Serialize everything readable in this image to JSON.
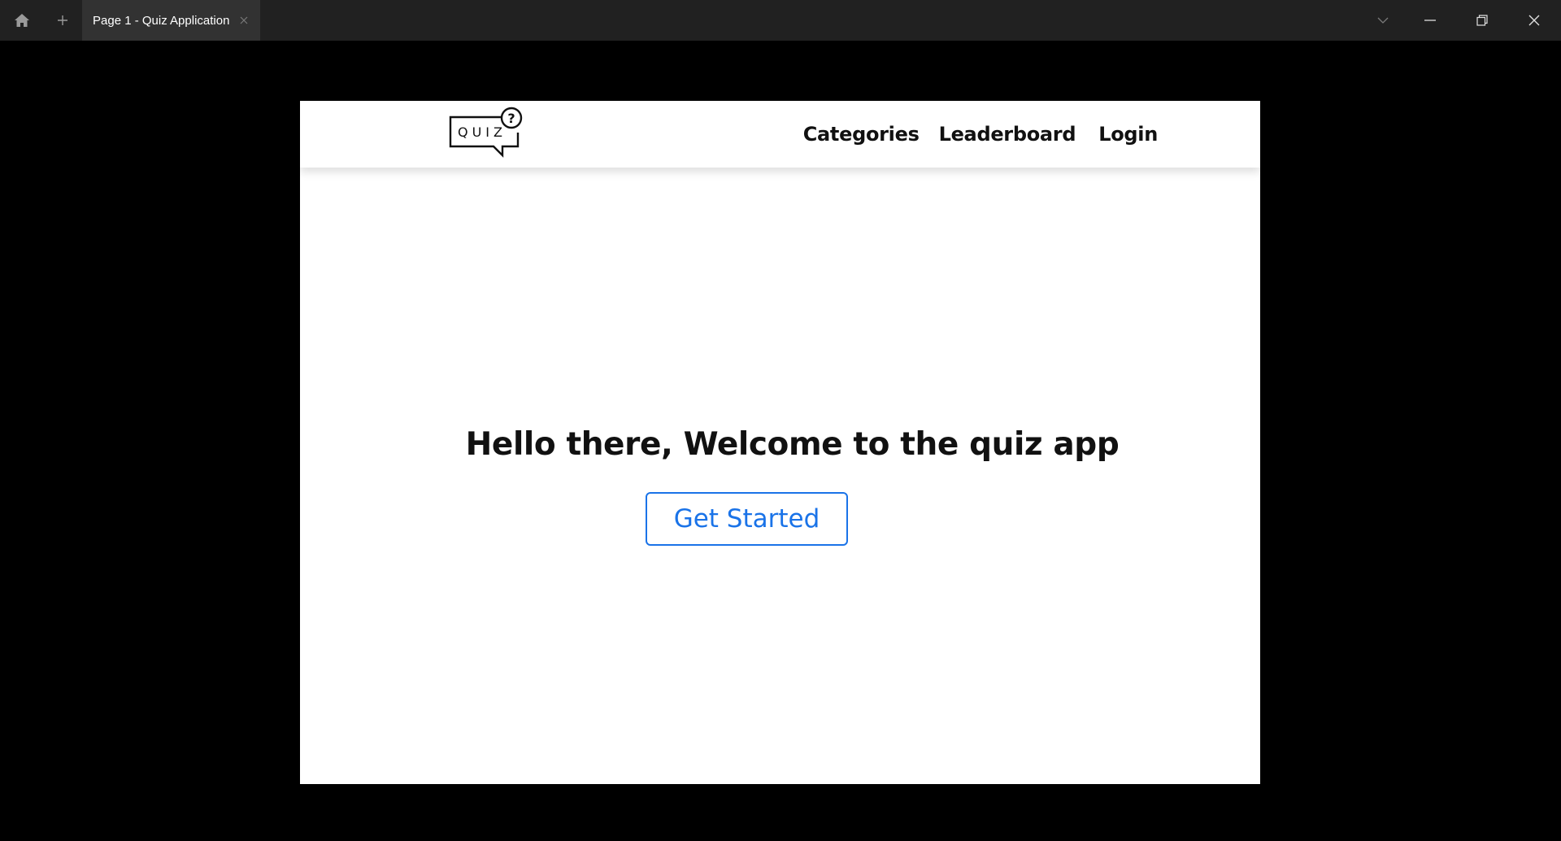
{
  "browser": {
    "tab_title": "Page 1 - Quiz Application",
    "icons": {
      "home": "home-icon",
      "new_tab": "plus-icon",
      "tab_close": "close-icon",
      "tabs_dropdown": "chevron-down-icon",
      "minimize": "minimize-icon",
      "restore": "restore-icon",
      "close": "close-icon"
    }
  },
  "navbar": {
    "logo_text": "QUIZ",
    "links": {
      "categories": "Categories",
      "leaderboard": "Leaderboard",
      "login": "Login"
    }
  },
  "hero": {
    "title": "Hello there, Welcome to the quiz app",
    "cta_label": "Get Started"
  },
  "colors": {
    "accent": "#1a73e8",
    "titlebar": "#212121",
    "tab_active": "#323232",
    "background": "#000000",
    "page": "#ffffff"
  }
}
